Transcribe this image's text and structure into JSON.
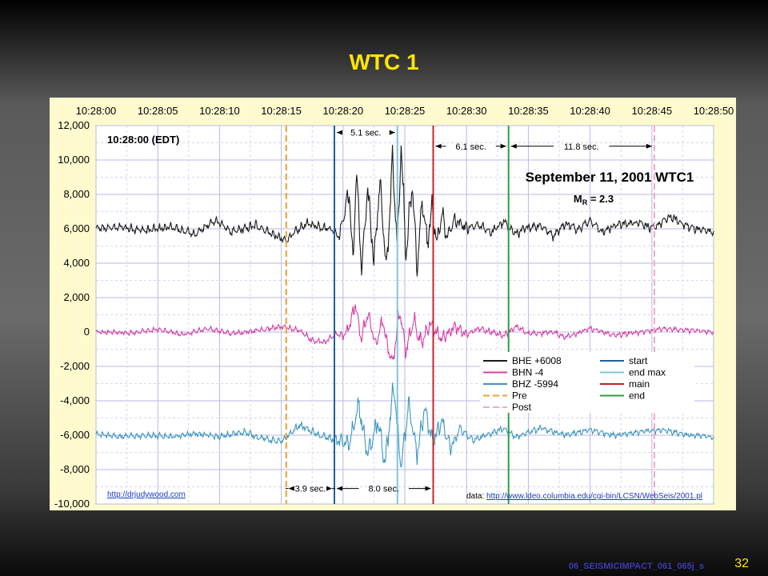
{
  "slide": {
    "title": "WTC 1",
    "footer_code": "06_SEISMICIMPACT_061_065j_s",
    "slide_number": "32"
  },
  "colors": {
    "title": "#ffe600",
    "panel_bg": "#fffbcf",
    "bhe": "#1a1a1a",
    "bhn": "#d33fa6",
    "bhz": "#3f97bf",
    "start": "#1f5fa0",
    "end_max": "#7fc6d8",
    "main": "#c4272c",
    "end": "#2f9e3f",
    "pre": "#f0a030",
    "post": "#f2a9c6"
  },
  "chart_data": {
    "type": "line",
    "title": "September 11, 2001 WTC1",
    "subtitle_prefix": "M",
    "subtitle_sub": "R",
    "subtitle_suffix": " = 2.3",
    "time_label": "10:28:00 (EDT)",
    "x_ticks": [
      "10:28:00",
      "10:28:05",
      "10:28:10",
      "10:28:15",
      "10:28:20",
      "10:28:25",
      "10:28:30",
      "10:28:35",
      "10:28:40",
      "10:28:45",
      "10:28:50"
    ],
    "xlim": [
      0,
      50
    ],
    "ylim": [
      -10000,
      12000
    ],
    "y_ticks": [
      12000,
      10000,
      8000,
      6000,
      4000,
      2000,
      0,
      -2000,
      -4000,
      -6000,
      -8000,
      -10000
    ],
    "y_tick_labels": [
      "12,000",
      "10,000",
      "8,000",
      "6,000",
      "4,000",
      "2,000",
      "0",
      "-2,000",
      "-4,000",
      "-6,000",
      "-8,000",
      "-10,000"
    ],
    "grid": true,
    "series": [
      {
        "name": "BHE",
        "offset_label": "+6008",
        "baseline": 6008,
        "color": "#1a1a1a",
        "keypoints": [
          [
            0,
            6000
          ],
          [
            2,
            6100
          ],
          [
            4,
            5900
          ],
          [
            6,
            6100
          ],
          [
            8,
            5700
          ],
          [
            9.7,
            6500
          ],
          [
            11,
            5800
          ],
          [
            13,
            6200
          ],
          [
            14.5,
            5600
          ],
          [
            15.3,
            5300
          ],
          [
            17,
            6300
          ],
          [
            19,
            6000
          ],
          [
            19.7,
            5600
          ],
          [
            20.5,
            8200
          ],
          [
            20.8,
            4000
          ],
          [
            21.1,
            9400
          ],
          [
            21.5,
            3500
          ],
          [
            22,
            8300
          ],
          [
            22.5,
            4200
          ],
          [
            23,
            8800
          ],
          [
            23.5,
            3400
          ],
          [
            24,
            10000
          ],
          [
            24.4,
            5000
          ],
          [
            24.7,
            10900
          ],
          [
            25.1,
            4600
          ],
          [
            25.6,
            8600
          ],
          [
            26,
            3600
          ],
          [
            26.4,
            7800
          ],
          [
            26.8,
            5100
          ],
          [
            27.2,
            7200
          ],
          [
            27.6,
            5000
          ],
          [
            28,
            7000
          ],
          [
            28.4,
            5500
          ],
          [
            29,
            6500
          ],
          [
            30,
            6000
          ],
          [
            31,
            6200
          ],
          [
            32,
            5800
          ],
          [
            33,
            6400
          ],
          [
            34,
            5700
          ],
          [
            35,
            6100
          ],
          [
            36,
            6200
          ],
          [
            37,
            5600
          ],
          [
            38,
            6300
          ],
          [
            39,
            6000
          ],
          [
            40,
            6500
          ],
          [
            41,
            5800
          ],
          [
            42,
            6200
          ],
          [
            44,
            6400
          ],
          [
            45,
            6000
          ],
          [
            46.5,
            6700
          ],
          [
            48,
            6100
          ],
          [
            50,
            5800
          ]
        ],
        "amp": [
          [
            0,
            280
          ],
          [
            19.5,
            300
          ],
          [
            20.5,
            700
          ],
          [
            24,
            900
          ],
          [
            27,
            800
          ],
          [
            29,
            500
          ],
          [
            31,
            300
          ],
          [
            50,
            280
          ]
        ]
      },
      {
        "name": "BHN",
        "offset_label": "-4",
        "baseline": -4,
        "color": "#d33fa6",
        "keypoints": [
          [
            0,
            0
          ],
          [
            3,
            -50
          ],
          [
            5,
            150
          ],
          [
            7,
            -150
          ],
          [
            9,
            200
          ],
          [
            11,
            -100
          ],
          [
            13,
            100
          ],
          [
            15,
            300
          ],
          [
            16.5,
            100
          ],
          [
            17.5,
            -500
          ],
          [
            18.5,
            -600
          ],
          [
            19.5,
            -100
          ],
          [
            20,
            -300
          ],
          [
            20.5,
            300
          ],
          [
            21,
            1600
          ],
          [
            21.5,
            -400
          ],
          [
            22,
            1100
          ],
          [
            22.6,
            -800
          ],
          [
            23.2,
            600
          ],
          [
            24,
            -1900
          ],
          [
            24.6,
            1300
          ],
          [
            25.1,
            -1200
          ],
          [
            25.7,
            800
          ],
          [
            26.3,
            -700
          ],
          [
            27,
            500
          ],
          [
            28,
            -400
          ],
          [
            29,
            300
          ],
          [
            30,
            -150
          ],
          [
            31,
            200
          ],
          [
            32,
            0
          ],
          [
            33,
            -200
          ],
          [
            34,
            300
          ],
          [
            35,
            -100
          ],
          [
            37,
            0
          ],
          [
            38,
            -300
          ],
          [
            40,
            200
          ],
          [
            42,
            -200
          ],
          [
            44,
            0
          ],
          [
            46,
            200
          ],
          [
            48,
            100
          ],
          [
            50,
            0
          ]
        ],
        "amp": [
          [
            0,
            150
          ],
          [
            19.5,
            200
          ],
          [
            21,
            500
          ],
          [
            25,
            700
          ],
          [
            28,
            450
          ],
          [
            31,
            200
          ],
          [
            50,
            150
          ]
        ]
      },
      {
        "name": "BHZ",
        "offset_label": "-5994",
        "baseline": -5994,
        "color": "#3f97bf",
        "keypoints": [
          [
            0,
            -5900
          ],
          [
            2,
            -6100
          ],
          [
            4,
            -6000
          ],
          [
            6,
            -6100
          ],
          [
            8,
            -5900
          ],
          [
            10,
            -6100
          ],
          [
            12,
            -5800
          ],
          [
            13,
            -6100
          ],
          [
            15,
            -6400
          ],
          [
            16.5,
            -5400
          ],
          [
            18,
            -6000
          ],
          [
            19.5,
            -6300
          ],
          [
            20.5,
            -6500
          ],
          [
            21.3,
            -4300
          ],
          [
            22,
            -7300
          ],
          [
            22.8,
            -5200
          ],
          [
            23.4,
            -7600
          ],
          [
            24.1,
            -3200
          ],
          [
            24.7,
            -7700
          ],
          [
            25.3,
            -4300
          ],
          [
            26,
            -7100
          ],
          [
            26.6,
            -4500
          ],
          [
            27.3,
            -6400
          ],
          [
            28,
            -5200
          ],
          [
            28.7,
            -6800
          ],
          [
            29.5,
            -5600
          ],
          [
            30.5,
            -6300
          ],
          [
            32,
            -5900
          ],
          [
            33,
            -5600
          ],
          [
            34,
            -6100
          ],
          [
            36,
            -5600
          ],
          [
            38,
            -6000
          ],
          [
            40,
            -5700
          ],
          [
            42,
            -6000
          ],
          [
            44,
            -5800
          ],
          [
            46,
            -5700
          ],
          [
            48,
            -6000
          ],
          [
            50,
            -6100
          ]
        ],
        "amp": [
          [
            0,
            180
          ],
          [
            19,
            250
          ],
          [
            21,
            700
          ],
          [
            24,
            800
          ],
          [
            27,
            650
          ],
          [
            29,
            400
          ],
          [
            31,
            200
          ],
          [
            50,
            180
          ]
        ]
      }
    ],
    "markers": [
      {
        "name": "Pre",
        "t": 15.4,
        "color": "#f0a030",
        "dashed": true
      },
      {
        "name": "start",
        "t": 19.3,
        "color": "#1f5fa0",
        "dashed": false
      },
      {
        "name": "end max",
        "t": 24.4,
        "color": "#7fc6d8",
        "dashed": false
      },
      {
        "name": "main",
        "t": 27.3,
        "color": "#c4272c",
        "dashed": false
      },
      {
        "name": "end",
        "t": 33.4,
        "color": "#2f9e3f",
        "dashed": false
      },
      {
        "name": "Post",
        "t": 45.2,
        "color": "#f2a9c6",
        "dashed": true
      }
    ],
    "annotations": [
      {
        "text": "5.1 sec.",
        "from": 19.3,
        "to": 24.4,
        "y": 11600
      },
      {
        "text": "6.1 sec.",
        "from": 27.3,
        "to": 33.4,
        "y": 10800
      },
      {
        "text": "11.8 sec.",
        "from": 33.4,
        "to": 45.2,
        "y": 10800
      },
      {
        "text": "3.9 sec.",
        "from": 15.4,
        "to": 19.3,
        "y": -9100
      },
      {
        "text": "8.0 sec.",
        "from": 19.3,
        "to": 27.3,
        "y": -9100
      }
    ],
    "legend": {
      "placement": "lower-right",
      "entries": [
        {
          "label": "BHE  +6008",
          "color": "#1a1a1a",
          "dashed": false
        },
        {
          "label": "BHN -4",
          "color": "#d33fa6",
          "dashed": false
        },
        {
          "label": "BHZ  -5994",
          "color": "#3f97bf",
          "dashed": false
        },
        {
          "label": "Pre",
          "color": "#f0a030",
          "dashed": true
        },
        {
          "label": "Post",
          "color": "#f2a9c6",
          "dashed": true
        },
        {
          "label": "start",
          "color": "#1f5fa0",
          "dashed": false
        },
        {
          "label": "end max",
          "color": "#7fc6d8",
          "dashed": false
        },
        {
          "label": "main",
          "color": "#c4272c",
          "dashed": false
        },
        {
          "label": "end",
          "color": "#2f9e3f",
          "dashed": false
        }
      ]
    },
    "credit_left": "http://drjudywood.com",
    "credit_right_prefix": "data: ",
    "credit_right_link": "http://www.ldeo.columbia.edu/cgi-bin/LCSN/WebSeis/2001.pl"
  }
}
